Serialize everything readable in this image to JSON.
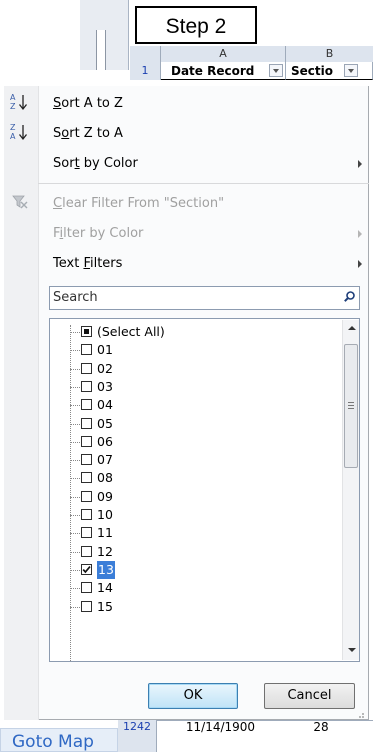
{
  "annotation": {
    "label": "Step 2"
  },
  "sheet": {
    "columns": [
      "A",
      "B"
    ],
    "row_number": "1",
    "headers": [
      "Date Record",
      "Sectio"
    ],
    "bottom_row": {
      "row": "1242",
      "date": "11/14/1900",
      "section": "28"
    }
  },
  "menu": {
    "sort_az": "Sort A to Z",
    "sort_za": "Sort Z to A",
    "sort_color": "Sort by Color",
    "clear_filter": "Clear Filter From \"Section\"",
    "filter_color": "Filter by Color",
    "text_filters": "Text Filters"
  },
  "search": {
    "placeholder": "Search"
  },
  "items": [
    {
      "label": "(Select All)",
      "state": "partial"
    },
    {
      "label": "01",
      "state": "off"
    },
    {
      "label": "02",
      "state": "off"
    },
    {
      "label": "03",
      "state": "off"
    },
    {
      "label": "04",
      "state": "off"
    },
    {
      "label": "05",
      "state": "off"
    },
    {
      "label": "06",
      "state": "off"
    },
    {
      "label": "07",
      "state": "off"
    },
    {
      "label": "08",
      "state": "off"
    },
    {
      "label": "09",
      "state": "off"
    },
    {
      "label": "10",
      "state": "off"
    },
    {
      "label": "11",
      "state": "off"
    },
    {
      "label": "12",
      "state": "off"
    },
    {
      "label": "13",
      "state": "on",
      "selected": true
    },
    {
      "label": "14",
      "state": "off"
    },
    {
      "label": "15",
      "state": "off"
    }
  ],
  "buttons": {
    "ok": "OK",
    "cancel": "Cancel"
  },
  "goto": {
    "label": "Goto Map"
  },
  "icons": {
    "sort_az": "sort-ascending-icon",
    "sort_za": "sort-descending-icon",
    "clear": "clear-filter-icon",
    "search": "search-icon"
  },
  "colors": {
    "selection": "#3b7ed8",
    "goto_text": "#2f68c4",
    "ok_border": "#3c7fb1"
  }
}
